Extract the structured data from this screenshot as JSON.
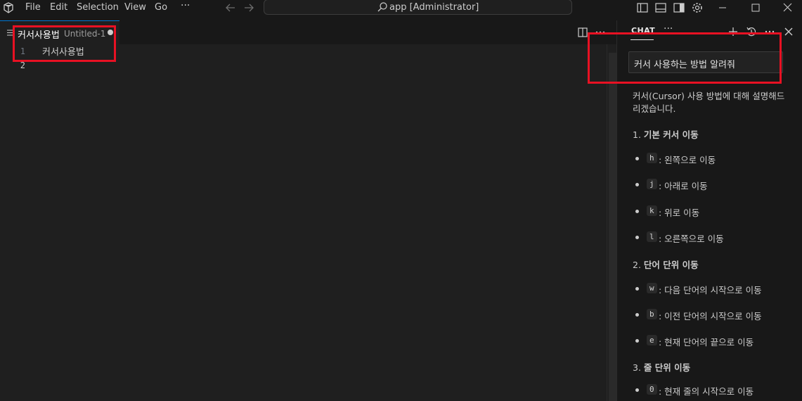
{
  "titlebar": {
    "menus": [
      "File",
      "Edit",
      "Selection",
      "View",
      "Go",
      "···"
    ],
    "search_text": "app [Administrator]"
  },
  "editor": {
    "tab_title": "커서사용법",
    "tab_description": "Untitled-1",
    "lines": [
      {
        "num": "1",
        "text": "커서사용법"
      },
      {
        "num": "2",
        "text": ""
      }
    ]
  },
  "chat": {
    "title": "CHAT",
    "more": "···",
    "prompt": "커서 사용하는 방법 알려줘",
    "intro": "커서(Cursor) 사용 방법에 대해 설명해드리겠습니다.",
    "sections": [
      {
        "heading_num": "1.",
        "heading": "기본 커서 이동",
        "items": [
          {
            "key": "h",
            "text": ": 왼쪽으로 이동"
          },
          {
            "key": "j",
            "text": ": 아래로 이동"
          },
          {
            "key": "k",
            "text": ": 위로 이동"
          },
          {
            "key": "l",
            "text": ": 오른쪽으로 이동"
          }
        ]
      },
      {
        "heading_num": "2.",
        "heading": "단어 단위 이동",
        "items": [
          {
            "key": "w",
            "text": ": 다음 단어의 시작으로 이동"
          },
          {
            "key": "b",
            "text": ": 이전 단어의 시작으로 이동"
          },
          {
            "key": "e",
            "text": ": 현재 단어의 끝으로 이동"
          }
        ]
      },
      {
        "heading_num": "3.",
        "heading": "줄 단위 이동",
        "items": [
          {
            "key": "0",
            "text": ": 현재 줄의 시작으로 이동"
          }
        ]
      }
    ]
  },
  "colors": {
    "background": "#181818",
    "editor_background": "#1f1f1f",
    "annotation_red": "#e81123"
  }
}
